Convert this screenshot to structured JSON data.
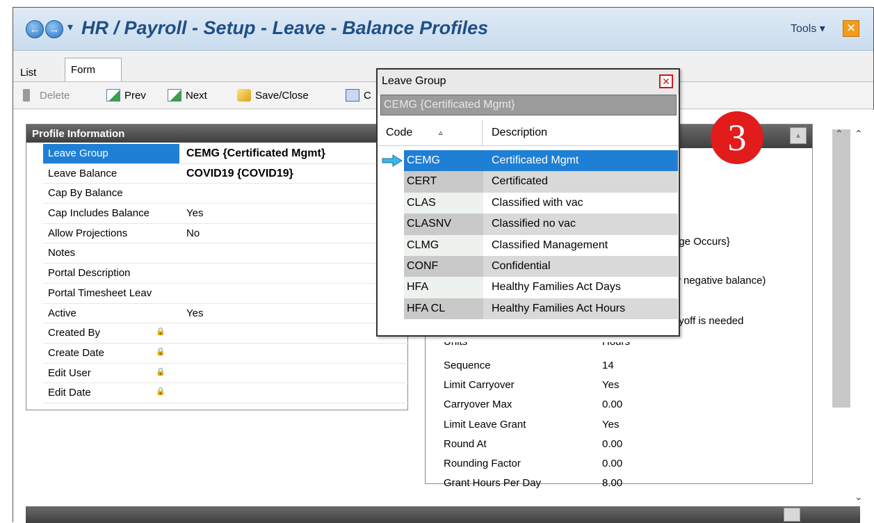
{
  "window": {
    "title": "HR / Payroll - Setup - Leave - Balance Profiles",
    "tools_label": "Tools ▾",
    "close_glyph": "✕"
  },
  "tabs": [
    {
      "label": "List",
      "active": false
    },
    {
      "label": "Form",
      "active": true
    }
  ],
  "toolbar": {
    "delete_label": "Delete",
    "prev_label": "Prev",
    "next_label": "Next",
    "save_close_label": "Save/Close",
    "other_label": "C"
  },
  "profile_panel": {
    "header": "Profile Information",
    "rows": [
      {
        "label": "Leave Group",
        "value": "CEMG {Certificated Mgmt}",
        "bold": true,
        "selected": true,
        "locked": false
      },
      {
        "label": "Leave Balance",
        "value": "COVID19 {COVID19}",
        "bold": true,
        "selected": false,
        "locked": false
      },
      {
        "label": "Cap By Balance",
        "value": "",
        "bold": false,
        "selected": false,
        "locked": false
      },
      {
        "label": "Cap Includes Balance",
        "value": "Yes",
        "bold": false,
        "selected": false,
        "locked": false
      },
      {
        "label": "Allow Projections",
        "value": "No",
        "bold": false,
        "selected": false,
        "locked": false
      },
      {
        "label": "Notes",
        "value": "",
        "bold": false,
        "selected": false,
        "locked": false
      },
      {
        "label": "Portal Description",
        "value": "",
        "bold": false,
        "selected": false,
        "locked": false
      },
      {
        "label": "Portal Timesheet Leav",
        "value": "",
        "bold": false,
        "selected": false,
        "locked": false
      },
      {
        "label": "Active",
        "value": "Yes",
        "bold": false,
        "selected": false,
        "locked": false
      },
      {
        "label": "Created By",
        "value": "",
        "bold": false,
        "selected": false,
        "locked": true
      },
      {
        "label": "Create Date",
        "value": "",
        "bold": false,
        "selected": false,
        "locked": true
      },
      {
        "label": "Edit User",
        "value": "",
        "bold": false,
        "selected": false,
        "locked": true
      },
      {
        "label": "Edit Date",
        "value": "",
        "bold": false,
        "selected": false,
        "locked": true
      }
    ]
  },
  "right_panel": {
    "partial_texts": [
      "nge Occurs}",
      "w negative balance)",
      "ayoff is needed",
      "Units",
      "Hours"
    ],
    "rows": [
      {
        "label": "Sequence",
        "value": "14"
      },
      {
        "label": "Limit Carryover",
        "value": "Yes"
      },
      {
        "label": "Carryover Max",
        "value": "0.00"
      },
      {
        "label": "Limit Leave Grant",
        "value": "Yes"
      },
      {
        "label": "Round At",
        "value": "0.00"
      },
      {
        "label": "Rounding Factor",
        "value": "0.00"
      },
      {
        "label": "Grant Hours Per Day",
        "value": "8.00"
      }
    ]
  },
  "step_badge": "3",
  "popup": {
    "title": "Leave Group",
    "close_glyph": "✕",
    "search_value": "CEMG {Certificated Mgmt}",
    "col_code": "Code",
    "col_desc": "Description",
    "sort_glyph": "▵",
    "rows": [
      {
        "code": "CEMG",
        "desc": "Certificated Mgmt",
        "selected": true
      },
      {
        "code": "CERT",
        "desc": "Certificated",
        "selected": false
      },
      {
        "code": "CLAS",
        "desc": "Classified with vac",
        "selected": false
      },
      {
        "code": "CLASNV",
        "desc": "Classified no vac",
        "selected": false
      },
      {
        "code": "CLMG",
        "desc": "Classified Management",
        "selected": false
      },
      {
        "code": "CONF",
        "desc": "Confidential",
        "selected": false
      },
      {
        "code": "HFA",
        "desc": "Healthy Families Act Days",
        "selected": false
      },
      {
        "code": "HFA CL",
        "desc": "Healthy Families Act Hours",
        "selected": false
      }
    ]
  },
  "colors": {
    "selection": "#1f7fd4",
    "title_text": "#1f4f86",
    "badge": "#e21b1b",
    "popup_close": "#d01515"
  }
}
